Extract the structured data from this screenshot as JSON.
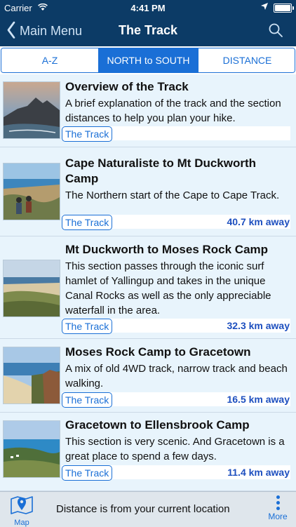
{
  "status_bar": {
    "carrier": "Carrier",
    "time": "4:41 PM"
  },
  "nav": {
    "back_label": "Main Menu",
    "title": "The Track"
  },
  "tabs": [
    {
      "label": "A-Z",
      "active": false
    },
    {
      "label": "NORTH to SOUTH",
      "active": true
    },
    {
      "label": "DISTANCE",
      "active": false
    }
  ],
  "sections": [
    {
      "title": "Overview of the Track",
      "description": "A brief explanation of the track and the section distances to help you plan your hike.",
      "tag": "The Track",
      "distance": ""
    },
    {
      "title": "Cape Naturaliste to Mt Duckworth Camp",
      "description": "The Northern start of the Cape to Cape Track.",
      "tag": "The Track",
      "distance": "40.7 km away"
    },
    {
      "title": "Mt Duckworth to Moses Rock Camp",
      "description": "This section passes through the iconic surf hamlet of Yallingup and takes in the unique Canal Rocks as well as the only appreciable waterfall in the area.",
      "tag": "The Track",
      "distance": "32.3 km away"
    },
    {
      "title": "Moses Rock Camp to Gracetown",
      "description": "A mix of old 4WD track, narrow track and beach walking.",
      "tag": "The Track",
      "distance": "16.5 km away"
    },
    {
      "title": "Gracetown to Ellensbrook Camp",
      "description": "This section is very scenic. And Gracetown is a great place to spend a few days.",
      "tag": "The Track",
      "distance": "11.4 km away"
    }
  ],
  "bottom_bar": {
    "map_label": "Map",
    "note": "Distance is from your current location",
    "more_label": "More"
  },
  "colors": {
    "nav_bar": "#0c3b66",
    "accent": "#1a6fd6",
    "distance_text": "#1d4fbf",
    "row_background": "#e8f4fc"
  },
  "icons": {
    "back": "chevron-left-icon",
    "search": "search-icon",
    "map": "map-pin-icon",
    "more": "more-vertical-icon"
  }
}
